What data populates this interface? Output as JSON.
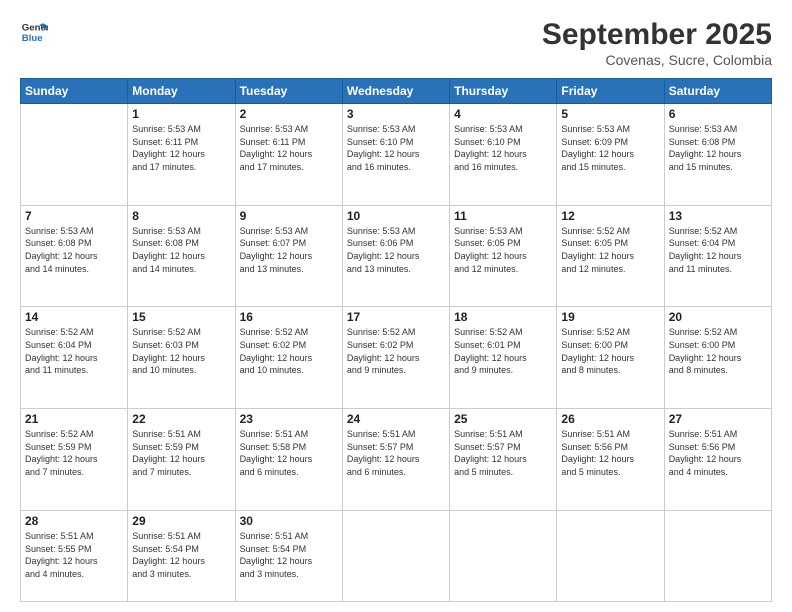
{
  "header": {
    "logo_line1": "General",
    "logo_line2": "Blue",
    "title": "September 2025",
    "subtitle": "Covenas, Sucre, Colombia"
  },
  "weekdays": [
    "Sunday",
    "Monday",
    "Tuesday",
    "Wednesday",
    "Thursday",
    "Friday",
    "Saturday"
  ],
  "weeks": [
    [
      {
        "day": "",
        "text": ""
      },
      {
        "day": "1",
        "text": "Sunrise: 5:53 AM\nSunset: 6:11 PM\nDaylight: 12 hours\nand 17 minutes."
      },
      {
        "day": "2",
        "text": "Sunrise: 5:53 AM\nSunset: 6:11 PM\nDaylight: 12 hours\nand 17 minutes."
      },
      {
        "day": "3",
        "text": "Sunrise: 5:53 AM\nSunset: 6:10 PM\nDaylight: 12 hours\nand 16 minutes."
      },
      {
        "day": "4",
        "text": "Sunrise: 5:53 AM\nSunset: 6:10 PM\nDaylight: 12 hours\nand 16 minutes."
      },
      {
        "day": "5",
        "text": "Sunrise: 5:53 AM\nSunset: 6:09 PM\nDaylight: 12 hours\nand 15 minutes."
      },
      {
        "day": "6",
        "text": "Sunrise: 5:53 AM\nSunset: 6:08 PM\nDaylight: 12 hours\nand 15 minutes."
      }
    ],
    [
      {
        "day": "7",
        "text": "Sunrise: 5:53 AM\nSunset: 6:08 PM\nDaylight: 12 hours\nand 14 minutes."
      },
      {
        "day": "8",
        "text": "Sunrise: 5:53 AM\nSunset: 6:08 PM\nDaylight: 12 hours\nand 14 minutes."
      },
      {
        "day": "9",
        "text": "Sunrise: 5:53 AM\nSunset: 6:07 PM\nDaylight: 12 hours\nand 13 minutes."
      },
      {
        "day": "10",
        "text": "Sunrise: 5:53 AM\nSunset: 6:06 PM\nDaylight: 12 hours\nand 13 minutes."
      },
      {
        "day": "11",
        "text": "Sunrise: 5:53 AM\nSunset: 6:05 PM\nDaylight: 12 hours\nand 12 minutes."
      },
      {
        "day": "12",
        "text": "Sunrise: 5:52 AM\nSunset: 6:05 PM\nDaylight: 12 hours\nand 12 minutes."
      },
      {
        "day": "13",
        "text": "Sunrise: 5:52 AM\nSunset: 6:04 PM\nDaylight: 12 hours\nand 11 minutes."
      }
    ],
    [
      {
        "day": "14",
        "text": "Sunrise: 5:52 AM\nSunset: 6:04 PM\nDaylight: 12 hours\nand 11 minutes."
      },
      {
        "day": "15",
        "text": "Sunrise: 5:52 AM\nSunset: 6:03 PM\nDaylight: 12 hours\nand 10 minutes."
      },
      {
        "day": "16",
        "text": "Sunrise: 5:52 AM\nSunset: 6:02 PM\nDaylight: 12 hours\nand 10 minutes."
      },
      {
        "day": "17",
        "text": "Sunrise: 5:52 AM\nSunset: 6:02 PM\nDaylight: 12 hours\nand 9 minutes."
      },
      {
        "day": "18",
        "text": "Sunrise: 5:52 AM\nSunset: 6:01 PM\nDaylight: 12 hours\nand 9 minutes."
      },
      {
        "day": "19",
        "text": "Sunrise: 5:52 AM\nSunset: 6:00 PM\nDaylight: 12 hours\nand 8 minutes."
      },
      {
        "day": "20",
        "text": "Sunrise: 5:52 AM\nSunset: 6:00 PM\nDaylight: 12 hours\nand 8 minutes."
      }
    ],
    [
      {
        "day": "21",
        "text": "Sunrise: 5:52 AM\nSunset: 5:59 PM\nDaylight: 12 hours\nand 7 minutes."
      },
      {
        "day": "22",
        "text": "Sunrise: 5:51 AM\nSunset: 5:59 PM\nDaylight: 12 hours\nand 7 minutes."
      },
      {
        "day": "23",
        "text": "Sunrise: 5:51 AM\nSunset: 5:58 PM\nDaylight: 12 hours\nand 6 minutes."
      },
      {
        "day": "24",
        "text": "Sunrise: 5:51 AM\nSunset: 5:57 PM\nDaylight: 12 hours\nand 6 minutes."
      },
      {
        "day": "25",
        "text": "Sunrise: 5:51 AM\nSunset: 5:57 PM\nDaylight: 12 hours\nand 5 minutes."
      },
      {
        "day": "26",
        "text": "Sunrise: 5:51 AM\nSunset: 5:56 PM\nDaylight: 12 hours\nand 5 minutes."
      },
      {
        "day": "27",
        "text": "Sunrise: 5:51 AM\nSunset: 5:56 PM\nDaylight: 12 hours\nand 4 minutes."
      }
    ],
    [
      {
        "day": "28",
        "text": "Sunrise: 5:51 AM\nSunset: 5:55 PM\nDaylight: 12 hours\nand 4 minutes."
      },
      {
        "day": "29",
        "text": "Sunrise: 5:51 AM\nSunset: 5:54 PM\nDaylight: 12 hours\nand 3 minutes."
      },
      {
        "day": "30",
        "text": "Sunrise: 5:51 AM\nSunset: 5:54 PM\nDaylight: 12 hours\nand 3 minutes."
      },
      {
        "day": "",
        "text": ""
      },
      {
        "day": "",
        "text": ""
      },
      {
        "day": "",
        "text": ""
      },
      {
        "day": "",
        "text": ""
      }
    ]
  ]
}
